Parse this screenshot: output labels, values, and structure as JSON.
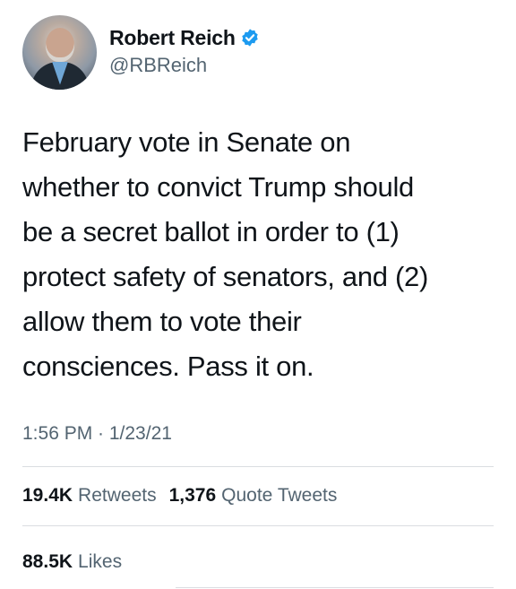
{
  "author": {
    "name": "Robert Reich",
    "handle": "@RBReich",
    "verified_icon": "verified-badge-icon",
    "verified_color": "#1d9bf0"
  },
  "tweet": {
    "text": "February vote in Senate on\nwhether to convict Trump should\nbe a secret ballot in order to (1)\nprotect safety of senators, and (2)\nallow them to vote their\nconsciences. Pass it on.",
    "timestamp": "1:56 PM · 1/23/21"
  },
  "stats": {
    "retweets_count": "19.4K",
    "retweets_label": "Retweets",
    "quotes_count": "1,376",
    "quotes_label": "Quote Tweets",
    "likes_count": "88.5K",
    "likes_label": "Likes"
  }
}
